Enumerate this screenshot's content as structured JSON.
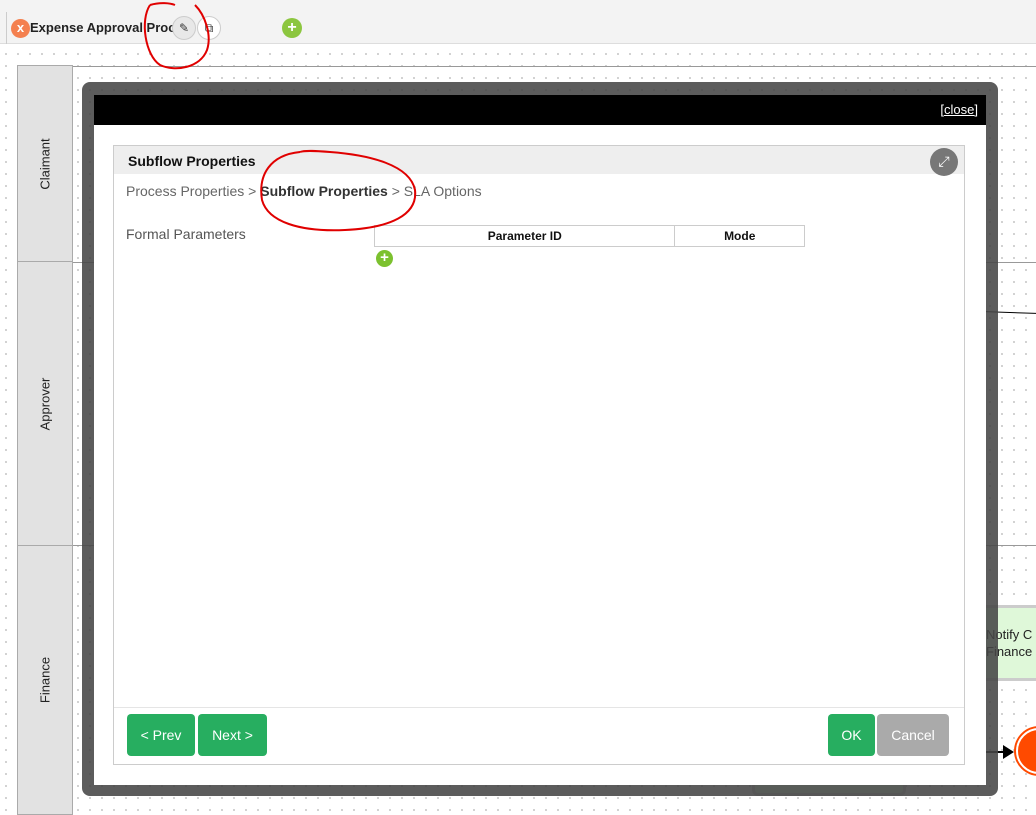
{
  "tab": {
    "title": "Expense Approval Process",
    "close_label": "x",
    "add_label": "+"
  },
  "lanes": [
    "Claimant",
    "Approver",
    "Finance"
  ],
  "canvas": {
    "notify_text_1": "Notify C",
    "notify_text_2": "Finance"
  },
  "modal": {
    "close_label": "[close]",
    "panel_title": "Subflow Properties",
    "breadcrumb": {
      "step1": "Process Properties",
      "sep": " > ",
      "step2": "Subflow Properties",
      "step3": "SLA Options"
    },
    "formal_parameters_label": "Formal Parameters",
    "table_headers": [
      "Parameter ID",
      "Mode"
    ],
    "add_label": "+",
    "buttons": {
      "prev": "< Prev",
      "next": "Next >",
      "ok": "OK",
      "cancel": "Cancel"
    }
  },
  "colors": {
    "primary": "#27ae60",
    "cancel": "#aaaaaa",
    "end_event": "#ff4a00",
    "annotation": "#e00000"
  }
}
